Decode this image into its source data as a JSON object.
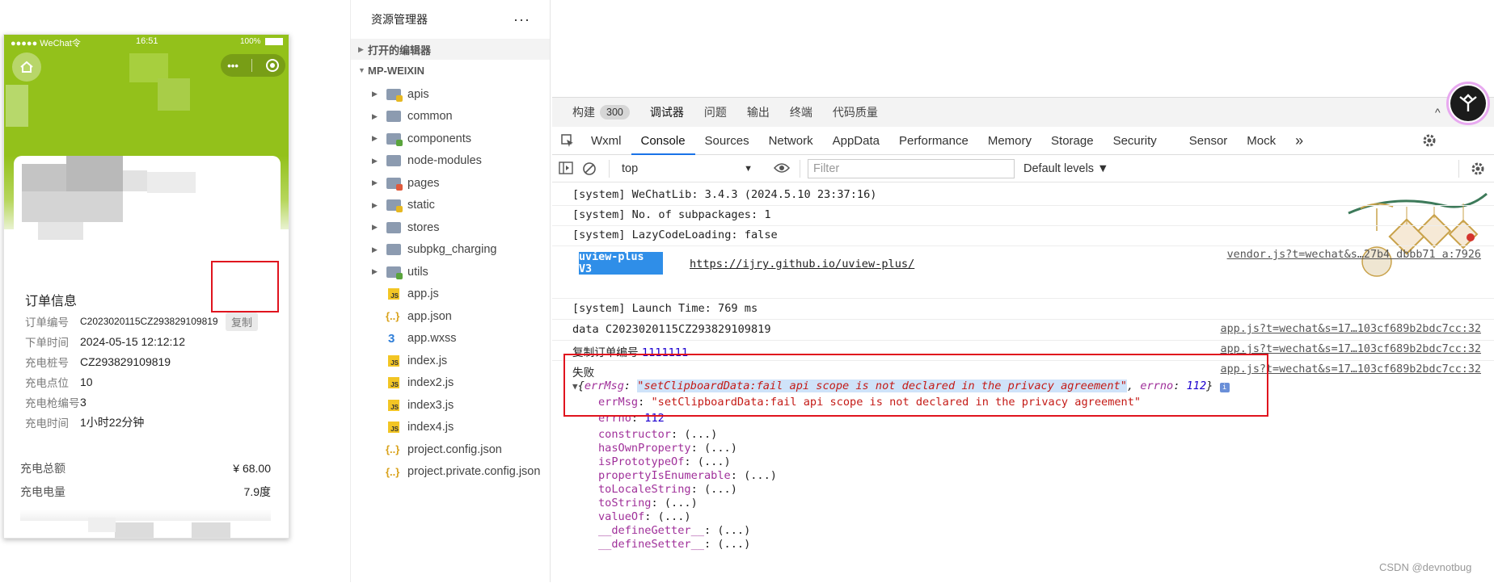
{
  "phone": {
    "carrier": "●●●●● WeChat令",
    "time": "16:51",
    "battery": "100%",
    "capsule_more": "•••",
    "order": {
      "title": "订单信息",
      "copy_btn": "复制",
      "rows": [
        {
          "k": "订单编号",
          "v": "C2023020115CZ293829109819"
        },
        {
          "k": "下单时间",
          "v": "2024-05-15  12:12:12"
        },
        {
          "k": "充电桩号",
          "v": "CZ293829109819"
        },
        {
          "k": "充电点位",
          "v": "10"
        },
        {
          "k": "充电枪编号",
          "v": "3"
        },
        {
          "k": "充电时间",
          "v": "1小时22分钟"
        }
      ]
    },
    "fees": [
      {
        "k": "充电总额",
        "v": "¥ 68.00"
      },
      {
        "k": "充电电量",
        "v": "7.9度"
      }
    ]
  },
  "explorer": {
    "title": "资源管理器",
    "more": "···",
    "sec_open": "打开的编辑器",
    "sec_project": "MP-WEIXIN",
    "items": [
      {
        "label": "apis",
        "kind": "folder",
        "badge": "y"
      },
      {
        "label": "common",
        "kind": "folder",
        "badge": ""
      },
      {
        "label": "components",
        "kind": "folder",
        "badge": "g"
      },
      {
        "label": "node-modules",
        "kind": "folder",
        "badge": ""
      },
      {
        "label": "pages",
        "kind": "folder",
        "badge": "r"
      },
      {
        "label": "static",
        "kind": "folder",
        "badge": "y"
      },
      {
        "label": "stores",
        "kind": "folder",
        "badge": ""
      },
      {
        "label": "subpkg_charging",
        "kind": "folder",
        "badge": ""
      },
      {
        "label": "utils",
        "kind": "folder",
        "badge": "g"
      },
      {
        "label": "app.js",
        "kind": "js"
      },
      {
        "label": "app.json",
        "kind": "json"
      },
      {
        "label": "app.wxss",
        "kind": "css"
      },
      {
        "label": "index.js",
        "kind": "js"
      },
      {
        "label": "index2.js",
        "kind": "js"
      },
      {
        "label": "index3.js",
        "kind": "js"
      },
      {
        "label": "index4.js",
        "kind": "js"
      },
      {
        "label": "project.config.json",
        "kind": "json"
      },
      {
        "label": "project.private.config.json",
        "kind": "json"
      }
    ]
  },
  "devtools": {
    "tabs1": [
      {
        "label": "构建",
        "count": "300"
      },
      {
        "label": "调试器",
        "count": ""
      },
      {
        "label": "问题",
        "count": ""
      },
      {
        "label": "输出",
        "count": ""
      },
      {
        "label": "终端",
        "count": ""
      },
      {
        "label": "代码质量",
        "count": ""
      }
    ],
    "tabs2": [
      "Wxml",
      "Console",
      "Sources",
      "Network",
      "AppData",
      "Performance",
      "Memory",
      "Storage",
      "Security",
      "Sensor",
      "Mock"
    ],
    "active_tab2": "Console",
    "more_tabs": "»",
    "context": "top",
    "filter_placeholder": "Filter",
    "levels": "Default levels ▼",
    "console": {
      "l1": "[system] WeChatLib: 3.4.3 (2024.5.10 23:37:16)",
      "l2": "[system] No. of subpackages: 1",
      "l3": "[system] LazyCodeLoading: false",
      "vendor_src": "vendor.js?t=wechat&s…27b4 dbbb71 a:7926",
      "uview_badge": "uview-plus V3",
      "uview_url": "https://ijry.github.io/uview-plus/",
      "l_launch": "[system] Launch Time: 769 ms",
      "data_line": "data C2023020115CZ293829109819",
      "app_src": "app.js?t=wechat&s=17…103cf689b2bdc7cc:32",
      "copy_line_label": "复制订单编号 ",
      "copy_line_val": "1111111",
      "fail_label": "失败",
      "obj_open": "{",
      "err_key": "errMsg",
      "err_val": "\"setClipboardData:fail api scope is not declared in the privacy agreement\"",
      "errno_key": "errno",
      "errno_val": "112",
      "obj_close": "}",
      "info_badge": "i",
      "props": [
        "constructor",
        "hasOwnProperty",
        "isPrototypeOf",
        "propertyIsEnumerable",
        "toLocaleString",
        "toString",
        "valueOf",
        "__defineGetter__",
        "__defineSetter__"
      ],
      "prop_val": "(...)"
    }
  },
  "watermark": "CSDN @devnotbug",
  "colors": {
    "brand_green": "#93c11b",
    "active_tab": "#1a73e8",
    "highlight_red": "#e0141e"
  }
}
